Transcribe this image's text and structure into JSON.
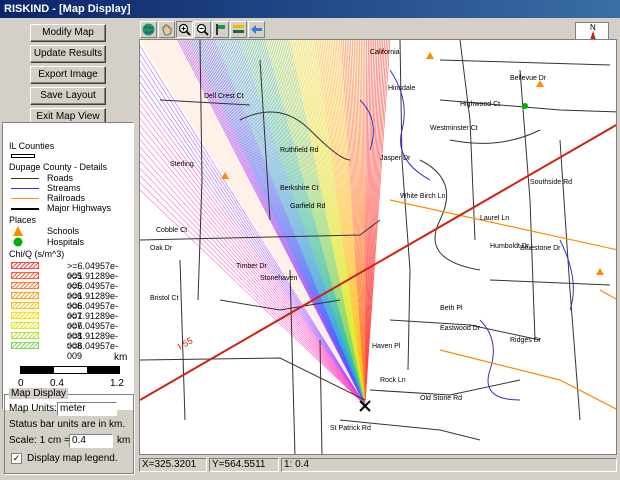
{
  "window": {
    "title": "RISKIND - [Map Display]"
  },
  "buttons": {
    "modify_map": "Modify Map",
    "update_results": "Update Results",
    "export_image": "Export Image",
    "save_layout": "Save Layout",
    "exit_map_view": "Exit Map View"
  },
  "legend": {
    "il_counties": "IL Counties",
    "dupage_details": "Dupage County - Details",
    "layers": [
      {
        "label": "Roads",
        "color": "#333333"
      },
      {
        "label": "Streams",
        "color": "#3030d0"
      },
      {
        "label": "Railroads",
        "color": "#ff8c00"
      },
      {
        "label": "Major Highways",
        "color": "#000000"
      }
    ],
    "places_title": "Places",
    "places": [
      {
        "label": "Schools",
        "icon": "school-triangle-icon",
        "color": "#ff8c00"
      },
      {
        "label": "Hospitals",
        "icon": "hospital-circle-icon",
        "color": "#00b000"
      }
    ],
    "chiq_title": "Chi/Q (s/m^3)",
    "chiq_levels": [
      {
        "label": ">=6.04957e-005",
        "color": "#ff4040"
      },
      {
        "label": ">=1.91289e-005",
        "color": "#ff5a3c"
      },
      {
        "label": ">=6.04957e-006",
        "color": "#ff7a30"
      },
      {
        "label": ">=1.91289e-006",
        "color": "#ffa020"
      },
      {
        "label": ">=6.04957e-007",
        "color": "#ffc020"
      },
      {
        "label": ">=1.91289e-007",
        "color": "#ffe000"
      },
      {
        "label": ">=6.04957e-008",
        "color": "#e0ea20"
      },
      {
        "label": ">=1.91289e-008",
        "color": "#b4e040"
      },
      {
        "label": ">=6.04957e-009",
        "color": "#80d860"
      }
    ]
  },
  "scale": {
    "unit": "km",
    "ticks": [
      "0",
      "0.4",
      "1.2"
    ]
  },
  "map_display": {
    "title": "Map Display",
    "map_units_label": "Map Units:",
    "map_units_value": "meter",
    "status_note": "Status bar units are in km.",
    "scale_label": "Scale: 1 cm =",
    "scale_value": "0.4",
    "scale_unit": "km",
    "display_legend_label": "Display map legend.",
    "display_legend_checked": true
  },
  "toolbar": {
    "icons": [
      "globe-icon",
      "pan-hand-icon",
      "zoom-in-icon",
      "zoom-out-icon",
      "flag-icon",
      "layers-icon",
      "back-arrow-icon"
    ]
  },
  "compass": {
    "label": "N"
  },
  "map": {
    "highway_label": "I-55",
    "streets": [
      "California",
      "Hinsdale",
      "Dell Crest Ct",
      "Westminster Ct",
      "Highwood Ct",
      "Bellevue Dr",
      "Jasper Dr",
      "Ruthfield Rd",
      "Garfield Rd",
      "Berkshire Ct",
      "Sterling",
      "White Birch Ln",
      "Bluestone Dr",
      "Laurel Ln",
      "Southside Rd",
      "Humboldt Dr",
      "Oak Dr",
      "Bristol Ct",
      "Rock Ln",
      "Old Stone Rd",
      "St Patrick Rd",
      "Eastwood Dr",
      "Ridges Dr",
      "Timber Dr",
      "Cobble Ct",
      "Stonehaven",
      "Haven Pl",
      "Beth Pl"
    ]
  },
  "status": {
    "x": "X=325.3201",
    "y": "Y=564.5511",
    "zoom": "1:  0.4"
  }
}
